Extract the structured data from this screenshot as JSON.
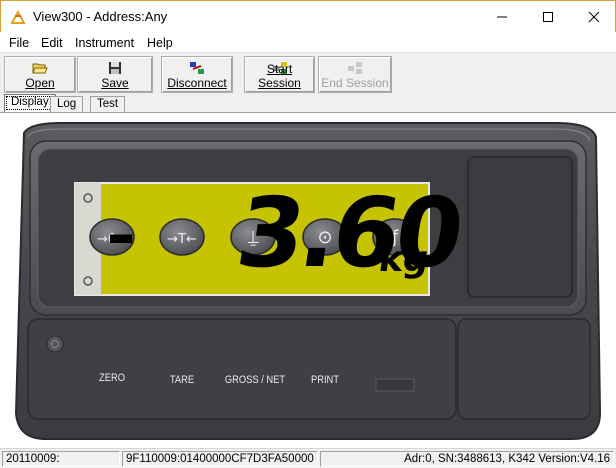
{
  "window": {
    "title": "View300 - Address:Any",
    "icon": "view300-icon"
  },
  "menu": [
    "File",
    "Edit",
    "Instrument",
    "Help"
  ],
  "toolbar": {
    "open_label": "Open",
    "save_label": "Save",
    "disconnect_label": "Disconnect",
    "start_session_label": "Start Session",
    "end_session_label": "End Session"
  },
  "tabs": [
    "Display",
    "Log",
    "Test"
  ],
  "active_tab": "Display",
  "indicator": {
    "sign": "-",
    "reading": "3.60",
    "unit": "kg",
    "lcd_color": "#c6c400",
    "buttons": [
      "ZERO",
      "TARE",
      "GROSS / NET",
      "PRINT"
    ]
  },
  "status": {
    "panel1": "20110009:",
    "panel2": "9F110009:01400000CF7D3FA50000",
    "panel3": "Adr:0, SN:3488613, K342 Version:V4.16"
  }
}
